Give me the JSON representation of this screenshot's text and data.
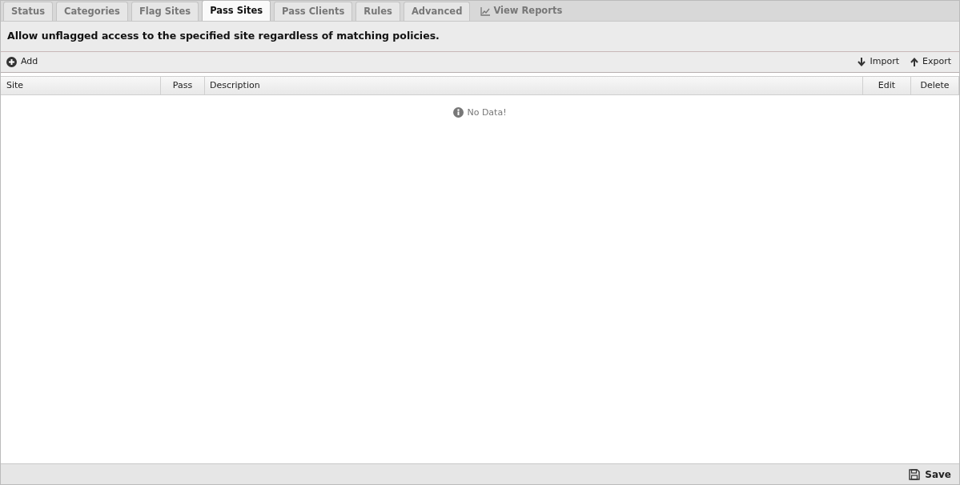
{
  "tabs": [
    {
      "label": "Status",
      "selected": false
    },
    {
      "label": "Categories",
      "selected": false
    },
    {
      "label": "Flag Sites",
      "selected": false
    },
    {
      "label": "Pass Sites",
      "selected": true
    },
    {
      "label": "Pass Clients",
      "selected": false
    },
    {
      "label": "Rules",
      "selected": false
    },
    {
      "label": "Advanced",
      "selected": false
    }
  ],
  "reports_link": "View Reports",
  "description": "Allow unflagged access to the specified site regardless of matching policies.",
  "toolbar": {
    "add": "Add",
    "import": "Import",
    "export": "Export"
  },
  "table": {
    "columns": [
      {
        "label": "Site",
        "kind": "wide"
      },
      {
        "label": "Pass",
        "kind": "center"
      },
      {
        "label": "Description",
        "kind": "flex"
      },
      {
        "label": "Edit",
        "kind": "center"
      },
      {
        "label": "Delete",
        "kind": "center"
      }
    ],
    "empty_message": "No Data!"
  },
  "save": "Save"
}
